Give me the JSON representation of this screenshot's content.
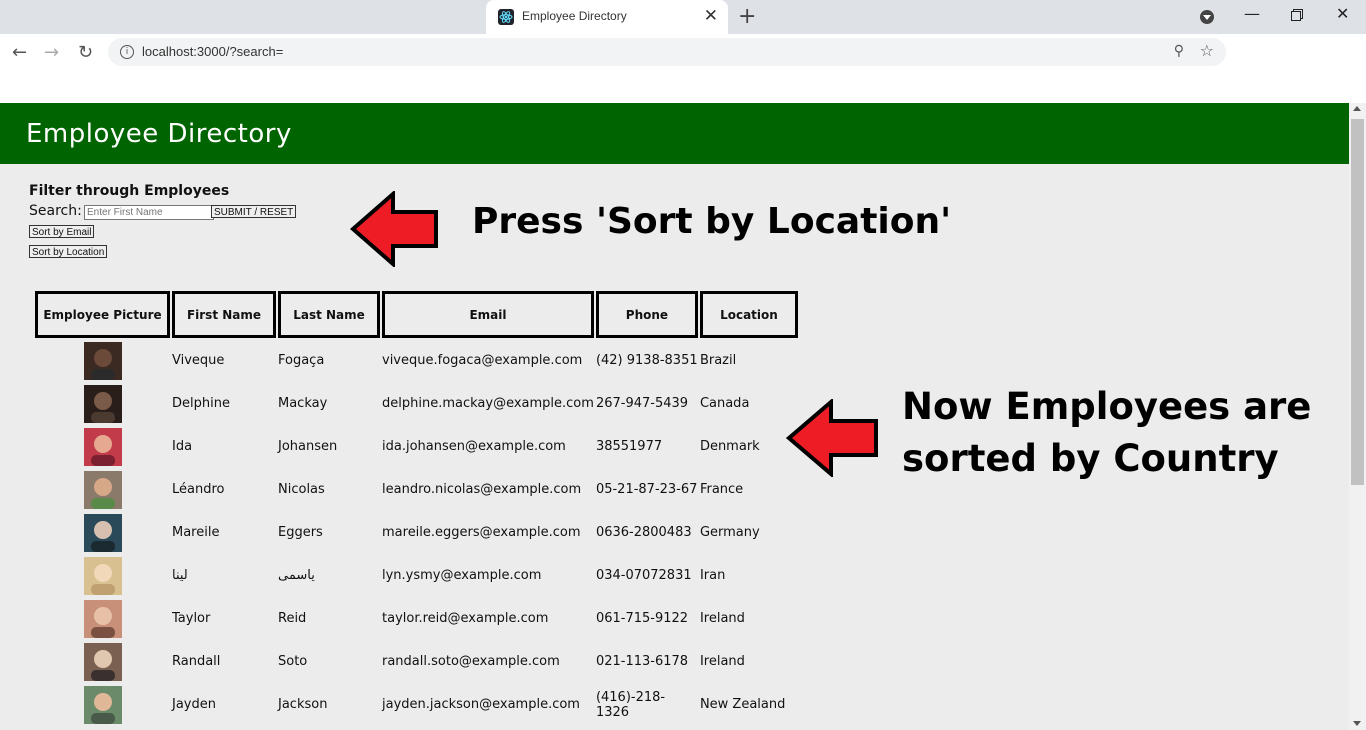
{
  "browser": {
    "tab_title": "Employee Directory",
    "url": "localhost:3000/?search=",
    "new_tab": "+",
    "close": "✕"
  },
  "app": {
    "title": "Employee Directory",
    "filter_heading": "Filter through Employees",
    "search_label": "Search:",
    "search_placeholder": "Enter First Name",
    "submit_label": "SUBMIT / RESET",
    "sort_email_label": "Sort by Email",
    "sort_location_label": "Sort by Location"
  },
  "annotations": {
    "top": "Press 'Sort by Location'",
    "side_line1": "Now Employees are",
    "side_line2": "sorted by Country",
    "arrow_color": "#ee1c25"
  },
  "table": {
    "headers": [
      "Employee Picture",
      "First Name",
      "Last Name",
      "Email",
      "Phone",
      "Location"
    ],
    "rows": [
      {
        "first": "Viveque",
        "last": "Fogaça",
        "email": "viveque.fogaca@example.com",
        "phone": "(42) 9138-8351",
        "location": "Brazil"
      },
      {
        "first": "Delphine",
        "last": "Mackay",
        "email": "delphine.mackay@example.com",
        "phone": "267-947-5439",
        "location": "Canada"
      },
      {
        "first": "Ida",
        "last": "Johansen",
        "email": "ida.johansen@example.com",
        "phone": "38551977",
        "location": "Denmark"
      },
      {
        "first": "Léandro",
        "last": "Nicolas",
        "email": "leandro.nicolas@example.com",
        "phone": "05-21-87-23-67",
        "location": "France"
      },
      {
        "first": "Mareile",
        "last": "Eggers",
        "email": "mareile.eggers@example.com",
        "phone": "0636-2800483",
        "location": "Germany"
      },
      {
        "first": "لينا",
        "last": "یاسمی",
        "email": "lyn.ysmy@example.com",
        "phone": "034-07072831",
        "location": "Iran"
      },
      {
        "first": "Taylor",
        "last": "Reid",
        "email": "taylor.reid@example.com",
        "phone": "061-715-9122",
        "location": "Ireland"
      },
      {
        "first": "Randall",
        "last": "Soto",
        "email": "randall.soto@example.com",
        "phone": "021-113-6178",
        "location": "Ireland"
      },
      {
        "first": "Jayden",
        "last": "Jackson",
        "email": "jayden.jackson@example.com",
        "phone": "(416)-218-1326",
        "location": "New Zealand"
      }
    ]
  },
  "colors": {
    "header_bg": "#006400",
    "page_bg": "#ececec"
  }
}
